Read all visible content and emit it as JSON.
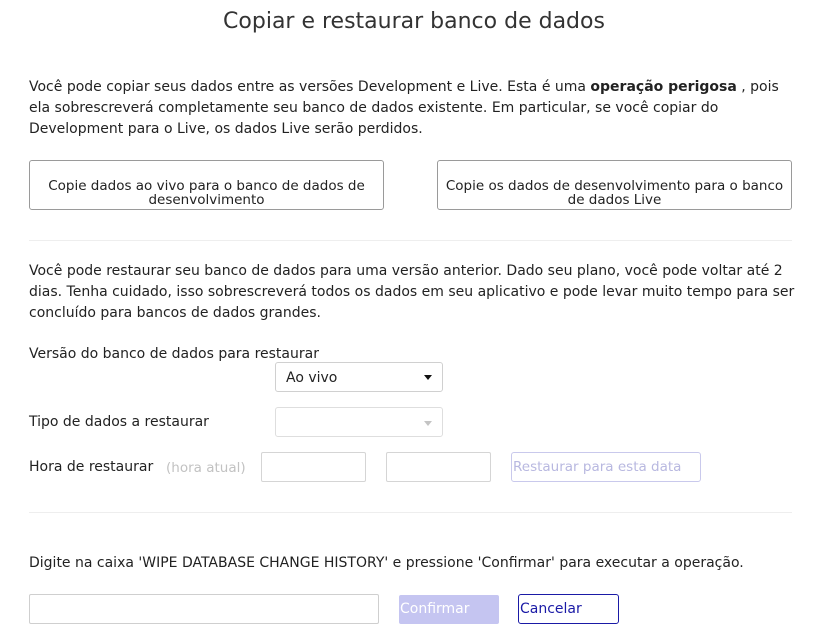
{
  "page": {
    "title": "Copiar e restaurar banco de dados"
  },
  "copy_section": {
    "intro_before": "Você pode copiar seus dados entre as versões Development e Live. Esta é uma ",
    "intro_bold": "operação perigosa",
    "intro_after": " , pois ela sobrescreverá completamente seu banco de dados existente. Em particular, se você copiar do Development para o Live, os dados Live serão perdidos.",
    "copy_live_to_dev_label": "Copie dados ao vivo para o banco de dados de desenvolvimento",
    "copy_dev_to_live_label": "Copie os dados de desenvolvimento para o banco de dados Live"
  },
  "restore_section": {
    "intro": "Você pode restaurar seu banco de dados para uma versão anterior. Dado seu plano, você pode voltar até 2 dias. Tenha cuidado, isso sobrescreverá todos os dados em seu aplicativo e pode levar muito tempo para ser concluído para bancos de dados grandes.",
    "version_label": "Versão do banco de dados para restaurar",
    "version_value": "Ao vivo",
    "data_type_label": "Tipo de dados a restaurar",
    "data_type_value": "",
    "time_label": "Hora de restaurar",
    "time_hint": "(hora atual)",
    "date_value": "",
    "time_value": "",
    "restore_button": "Restaurar para esta data"
  },
  "wipe_section": {
    "instruction": "Digite na caixa 'WIPE DATABASE CHANGE HISTORY' e pressione 'Confirmar' para executar a operação.",
    "input_value": "",
    "confirm_label": "Confirmar",
    "cancel_label": "Cancelar"
  }
}
